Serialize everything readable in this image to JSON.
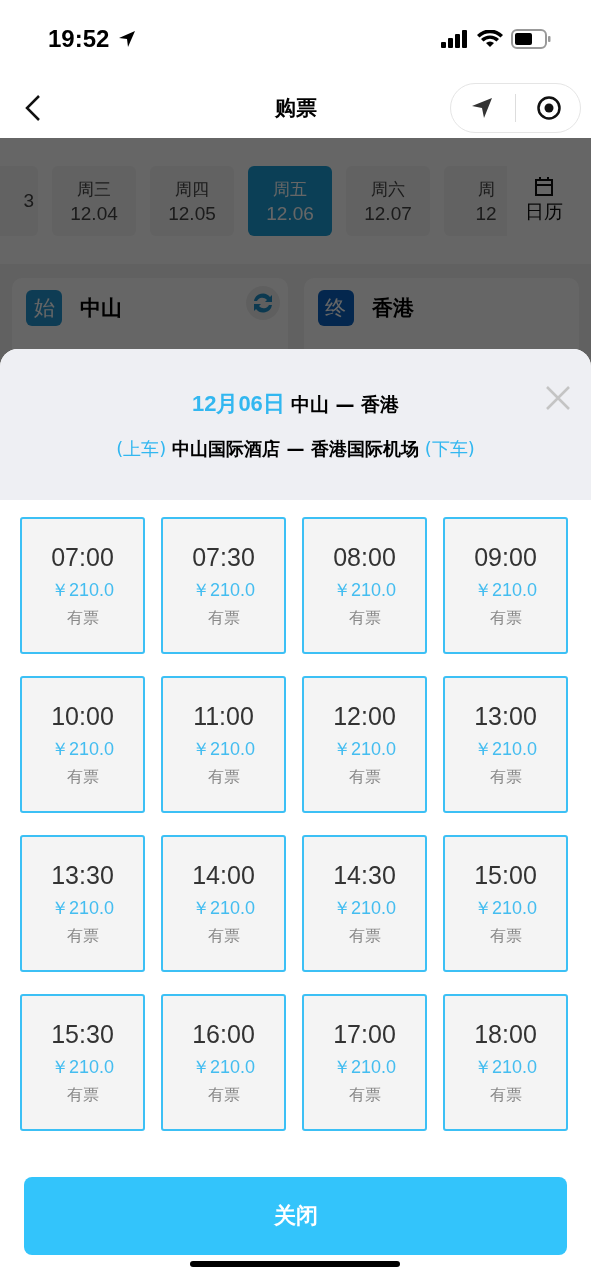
{
  "status_bar": {
    "time": "19:52"
  },
  "nav": {
    "title": "购票"
  },
  "date_tabs": [
    {
      "date": "3",
      "selected": false
    },
    {
      "weekday": "周三",
      "date": "12.04",
      "selected": false
    },
    {
      "weekday": "周四",
      "date": "12.05",
      "selected": false
    },
    {
      "weekday": "周五",
      "date": "12.06",
      "selected": true
    },
    {
      "weekday": "周六",
      "date": "12.07",
      "selected": false
    },
    {
      "weekday": "周",
      "date": "12",
      "selected": false
    }
  ],
  "calendar_button": {
    "label": "日历"
  },
  "stations": [
    {
      "badge": "始",
      "city": "中山",
      "kind": "origin"
    },
    {
      "badge": "终",
      "city": "香港",
      "kind": "destination"
    }
  ],
  "sheet": {
    "date": "12月06日",
    "route": "中山 — 香港",
    "board_tag": "(上车)",
    "stops": "中山国际酒店 — 香港国际机场",
    "alight_tag": "(下车)",
    "departures": [
      {
        "time": "07:00",
        "price": "￥210.0",
        "status": "有票"
      },
      {
        "time": "07:30",
        "price": "￥210.0",
        "status": "有票"
      },
      {
        "time": "08:00",
        "price": "￥210.0",
        "status": "有票"
      },
      {
        "time": "09:00",
        "price": "￥210.0",
        "status": "有票"
      },
      {
        "time": "10:00",
        "price": "￥210.0",
        "status": "有票"
      },
      {
        "time": "11:00",
        "price": "￥210.0",
        "status": "有票"
      },
      {
        "time": "12:00",
        "price": "￥210.0",
        "status": "有票"
      },
      {
        "time": "13:00",
        "price": "￥210.0",
        "status": "有票"
      },
      {
        "time": "13:30",
        "price": "￥210.0",
        "status": "有票"
      },
      {
        "time": "14:00",
        "price": "￥210.0",
        "status": "有票"
      },
      {
        "time": "14:30",
        "price": "￥210.0",
        "status": "有票"
      },
      {
        "time": "15:00",
        "price": "￥210.0",
        "status": "有票"
      },
      {
        "time": "15:30",
        "price": "￥210.0",
        "status": "有票"
      },
      {
        "time": "16:00",
        "price": "￥210.0",
        "status": "有票"
      },
      {
        "time": "17:00",
        "price": "￥210.0",
        "status": "有票"
      },
      {
        "time": "18:00",
        "price": "￥210.0",
        "status": "有票"
      }
    ],
    "close_button": "关闭"
  }
}
